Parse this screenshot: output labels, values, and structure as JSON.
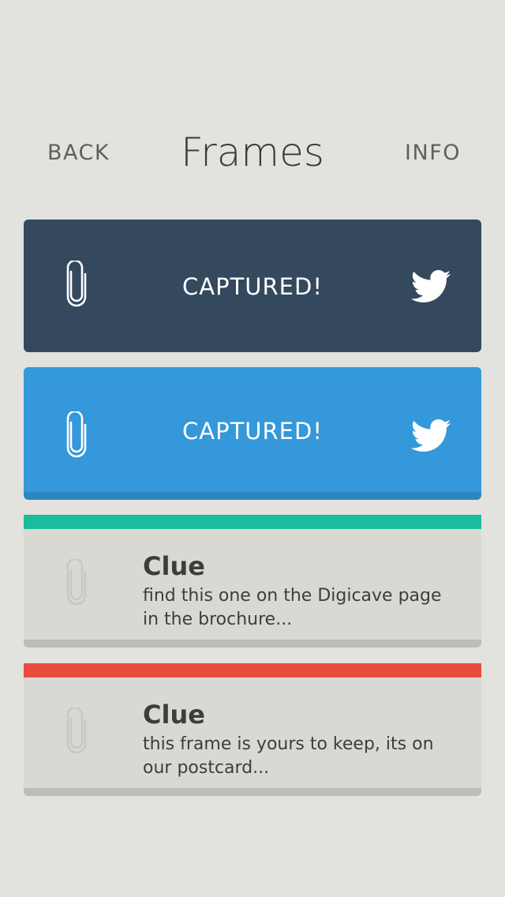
{
  "header": {
    "back_label": "BACK",
    "title": "Frames",
    "info_label": "INFO"
  },
  "cards": [
    {
      "status": "CAPTURED!",
      "color": "#34495e",
      "icon": "paperclip-icon",
      "share_icon": "twitter-icon"
    },
    {
      "status": "CAPTURED!",
      "color": "#3498db",
      "shadow_color": "#2e86c1",
      "icon": "paperclip-icon",
      "share_icon": "twitter-icon"
    }
  ],
  "clues": [
    {
      "title": "Clue",
      "text": "find this one on the Digicave page in the brochure...",
      "color": "#1abc9c",
      "icon": "paperclip-icon"
    },
    {
      "title": "Clue",
      "text": "this frame is yours to keep, its on our postcard...",
      "color": "#e74c3c",
      "icon": "paperclip-icon"
    }
  ]
}
